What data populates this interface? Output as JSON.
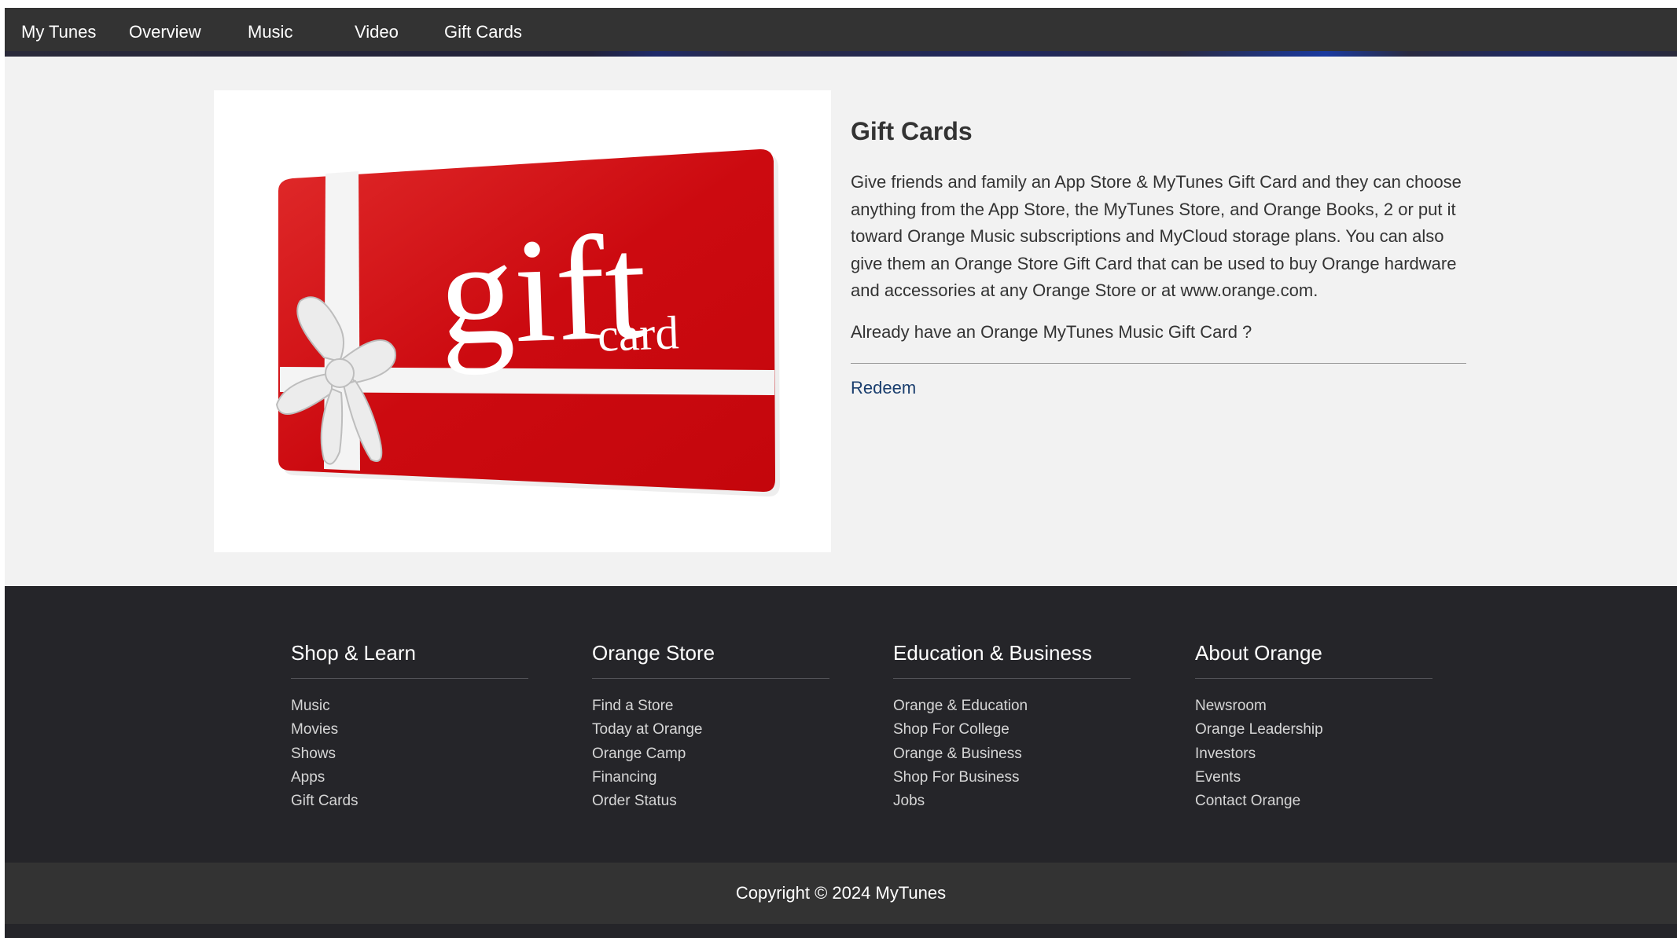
{
  "nav": {
    "brand": "My Tunes",
    "items": [
      {
        "label": "Overview"
      },
      {
        "label": "Music"
      },
      {
        "label": "Video"
      },
      {
        "label": "Gift Cards"
      }
    ]
  },
  "main": {
    "title": "Gift Cards",
    "image": {
      "text_large": "gift",
      "text_small": "card"
    },
    "description": "Give friends and family an App Store & MyTunes Gift Card and they can choose anything from the App Store, the MyTunes Store, and Orange Books, 2 or put it toward Orange Music subscriptions and MyCloud storage plans. You can also give them an Orange Store Gift Card that can be used to buy Orange hardware and accessories at any Orange Store or at www.orange.com.",
    "already_text": "Already have an Orange MyTunes Music Gift Card ?",
    "redeem_label": "Redeem"
  },
  "footer": {
    "columns": [
      {
        "title": "Shop & Learn",
        "links": [
          "Music",
          "Movies",
          "Shows",
          "Apps",
          "Gift Cards"
        ]
      },
      {
        "title": "Orange Store",
        "links": [
          "Find a Store",
          "Today at Orange",
          "Orange Camp",
          "Financing",
          "Order Status"
        ]
      },
      {
        "title": "Education & Business",
        "links": [
          "Orange & Education",
          "Shop For College",
          "Orange & Business",
          "Shop For Business",
          "Jobs"
        ]
      },
      {
        "title": "About Orange",
        "links": [
          "Newsroom",
          "Orange Leadership",
          "Investors",
          "Events",
          "Contact Orange"
        ]
      }
    ],
    "copyright": "Copyright © 2024 MyTunes"
  },
  "colors": {
    "nav_bg": "#333333",
    "page_bg": "#f2f2f2",
    "footer_bg": "#252529",
    "card_red": "#d10a10",
    "link_blue": "#1a3e6e"
  }
}
